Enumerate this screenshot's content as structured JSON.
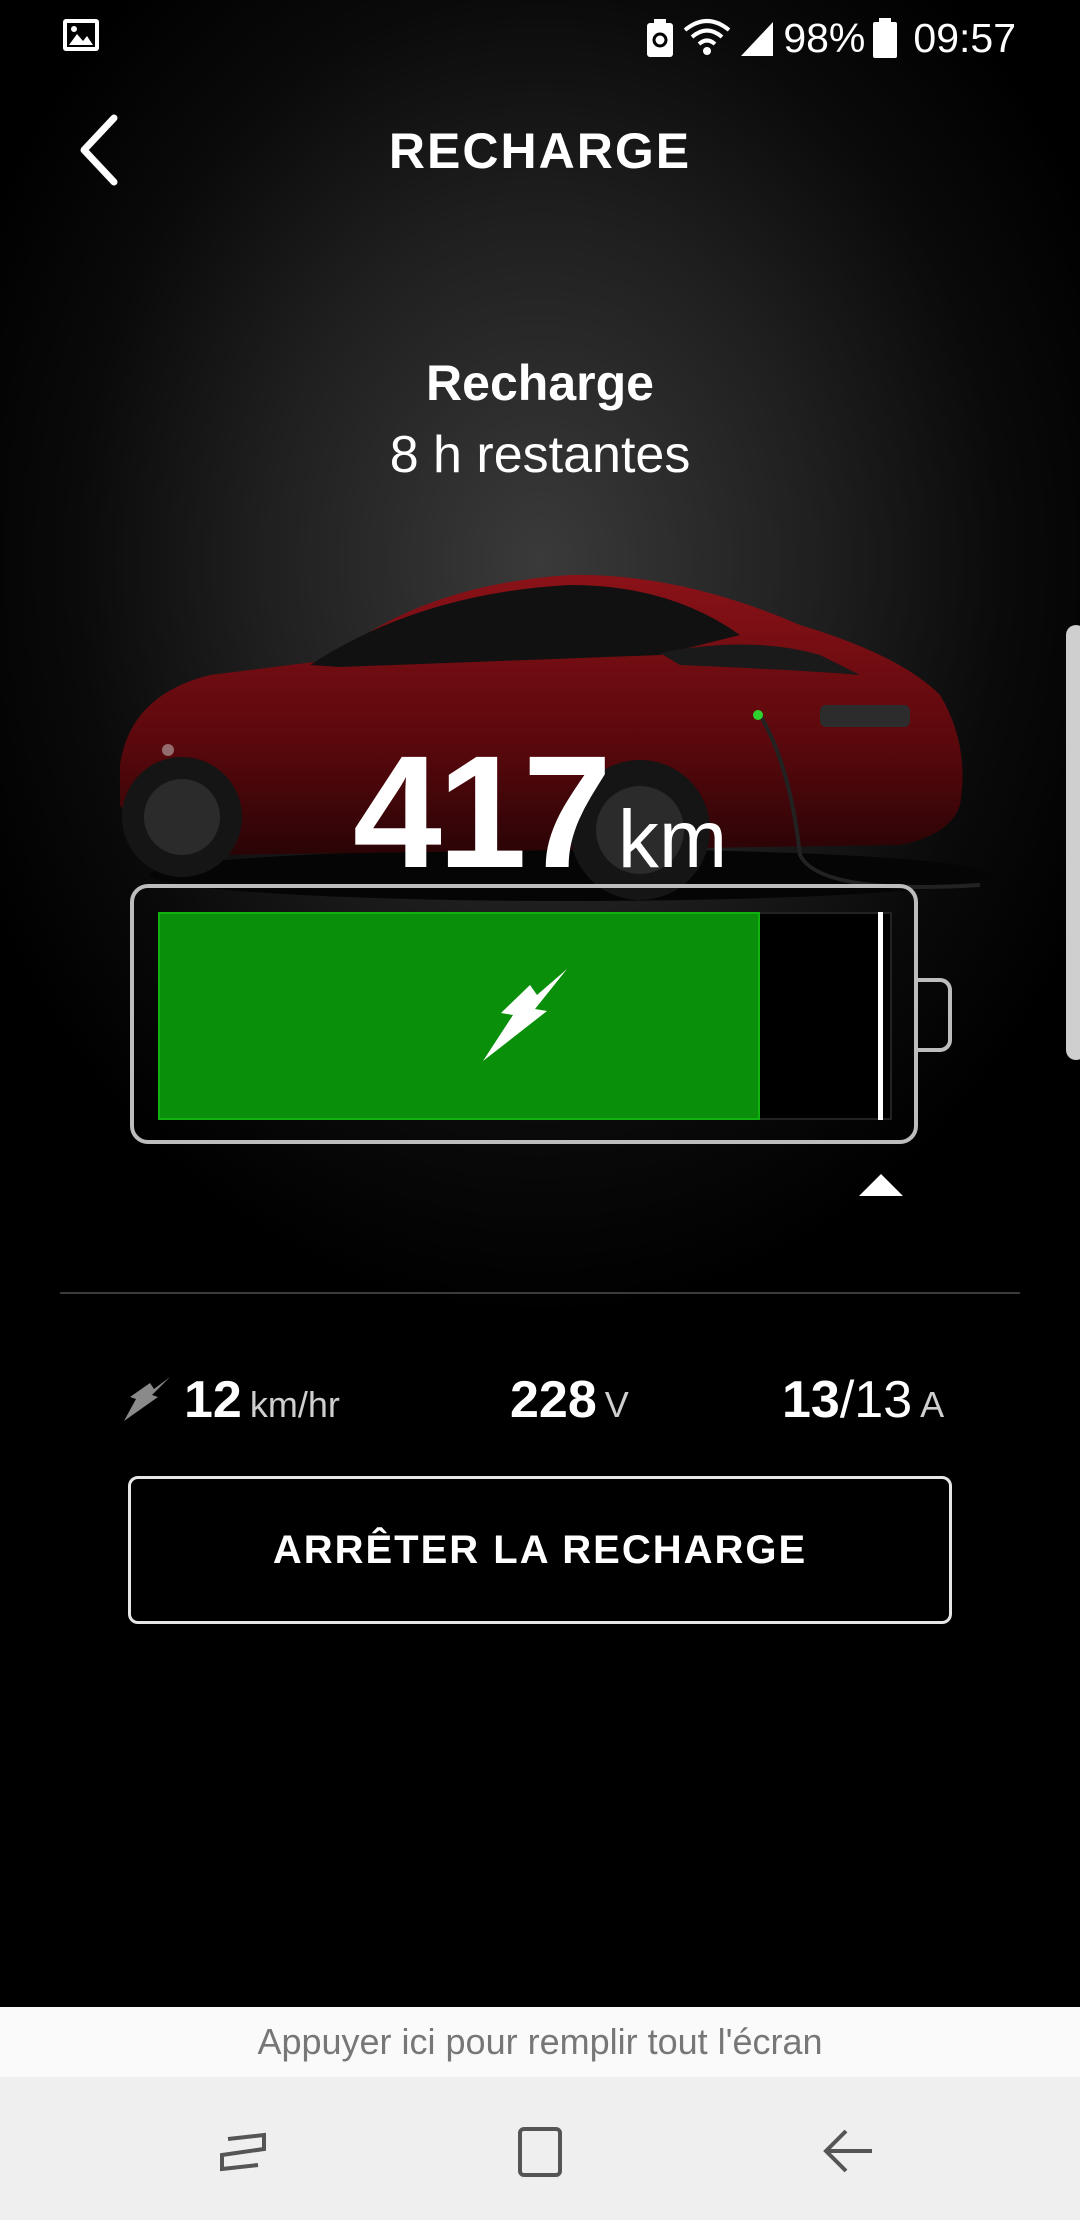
{
  "status_bar": {
    "battery_percent": "98%",
    "time": "09:57"
  },
  "header": {
    "title": "RECHARGE"
  },
  "charging": {
    "status": "Recharge",
    "time_remaining": "8 h restantes",
    "range_value": "417",
    "range_unit": "km",
    "battery_level": 0.82,
    "charge_limit": 0.985
  },
  "stats": {
    "rate_value": "12",
    "rate_unit": "km/hr",
    "voltage_value": "228",
    "voltage_unit": "V",
    "current_value": "13",
    "current_max": "/13",
    "current_unit": "A"
  },
  "actions": {
    "stop_label": "ARRÊTER LA RECHARGE"
  },
  "fullscreen_hint": "Appuyer ici pour remplir tout l'écran",
  "icons": {
    "back": "chevron-left-icon",
    "bolt": "lightning-bolt-icon",
    "rate": "charge-rate-icon",
    "limit": "triangle-up-icon",
    "nav_recent": "recent-apps-icon",
    "nav_home": "home-icon",
    "nav_back": "back-arrow-icon"
  },
  "colors": {
    "battery_fill": "#0a8f0a",
    "car_body": "#7a0c10"
  }
}
